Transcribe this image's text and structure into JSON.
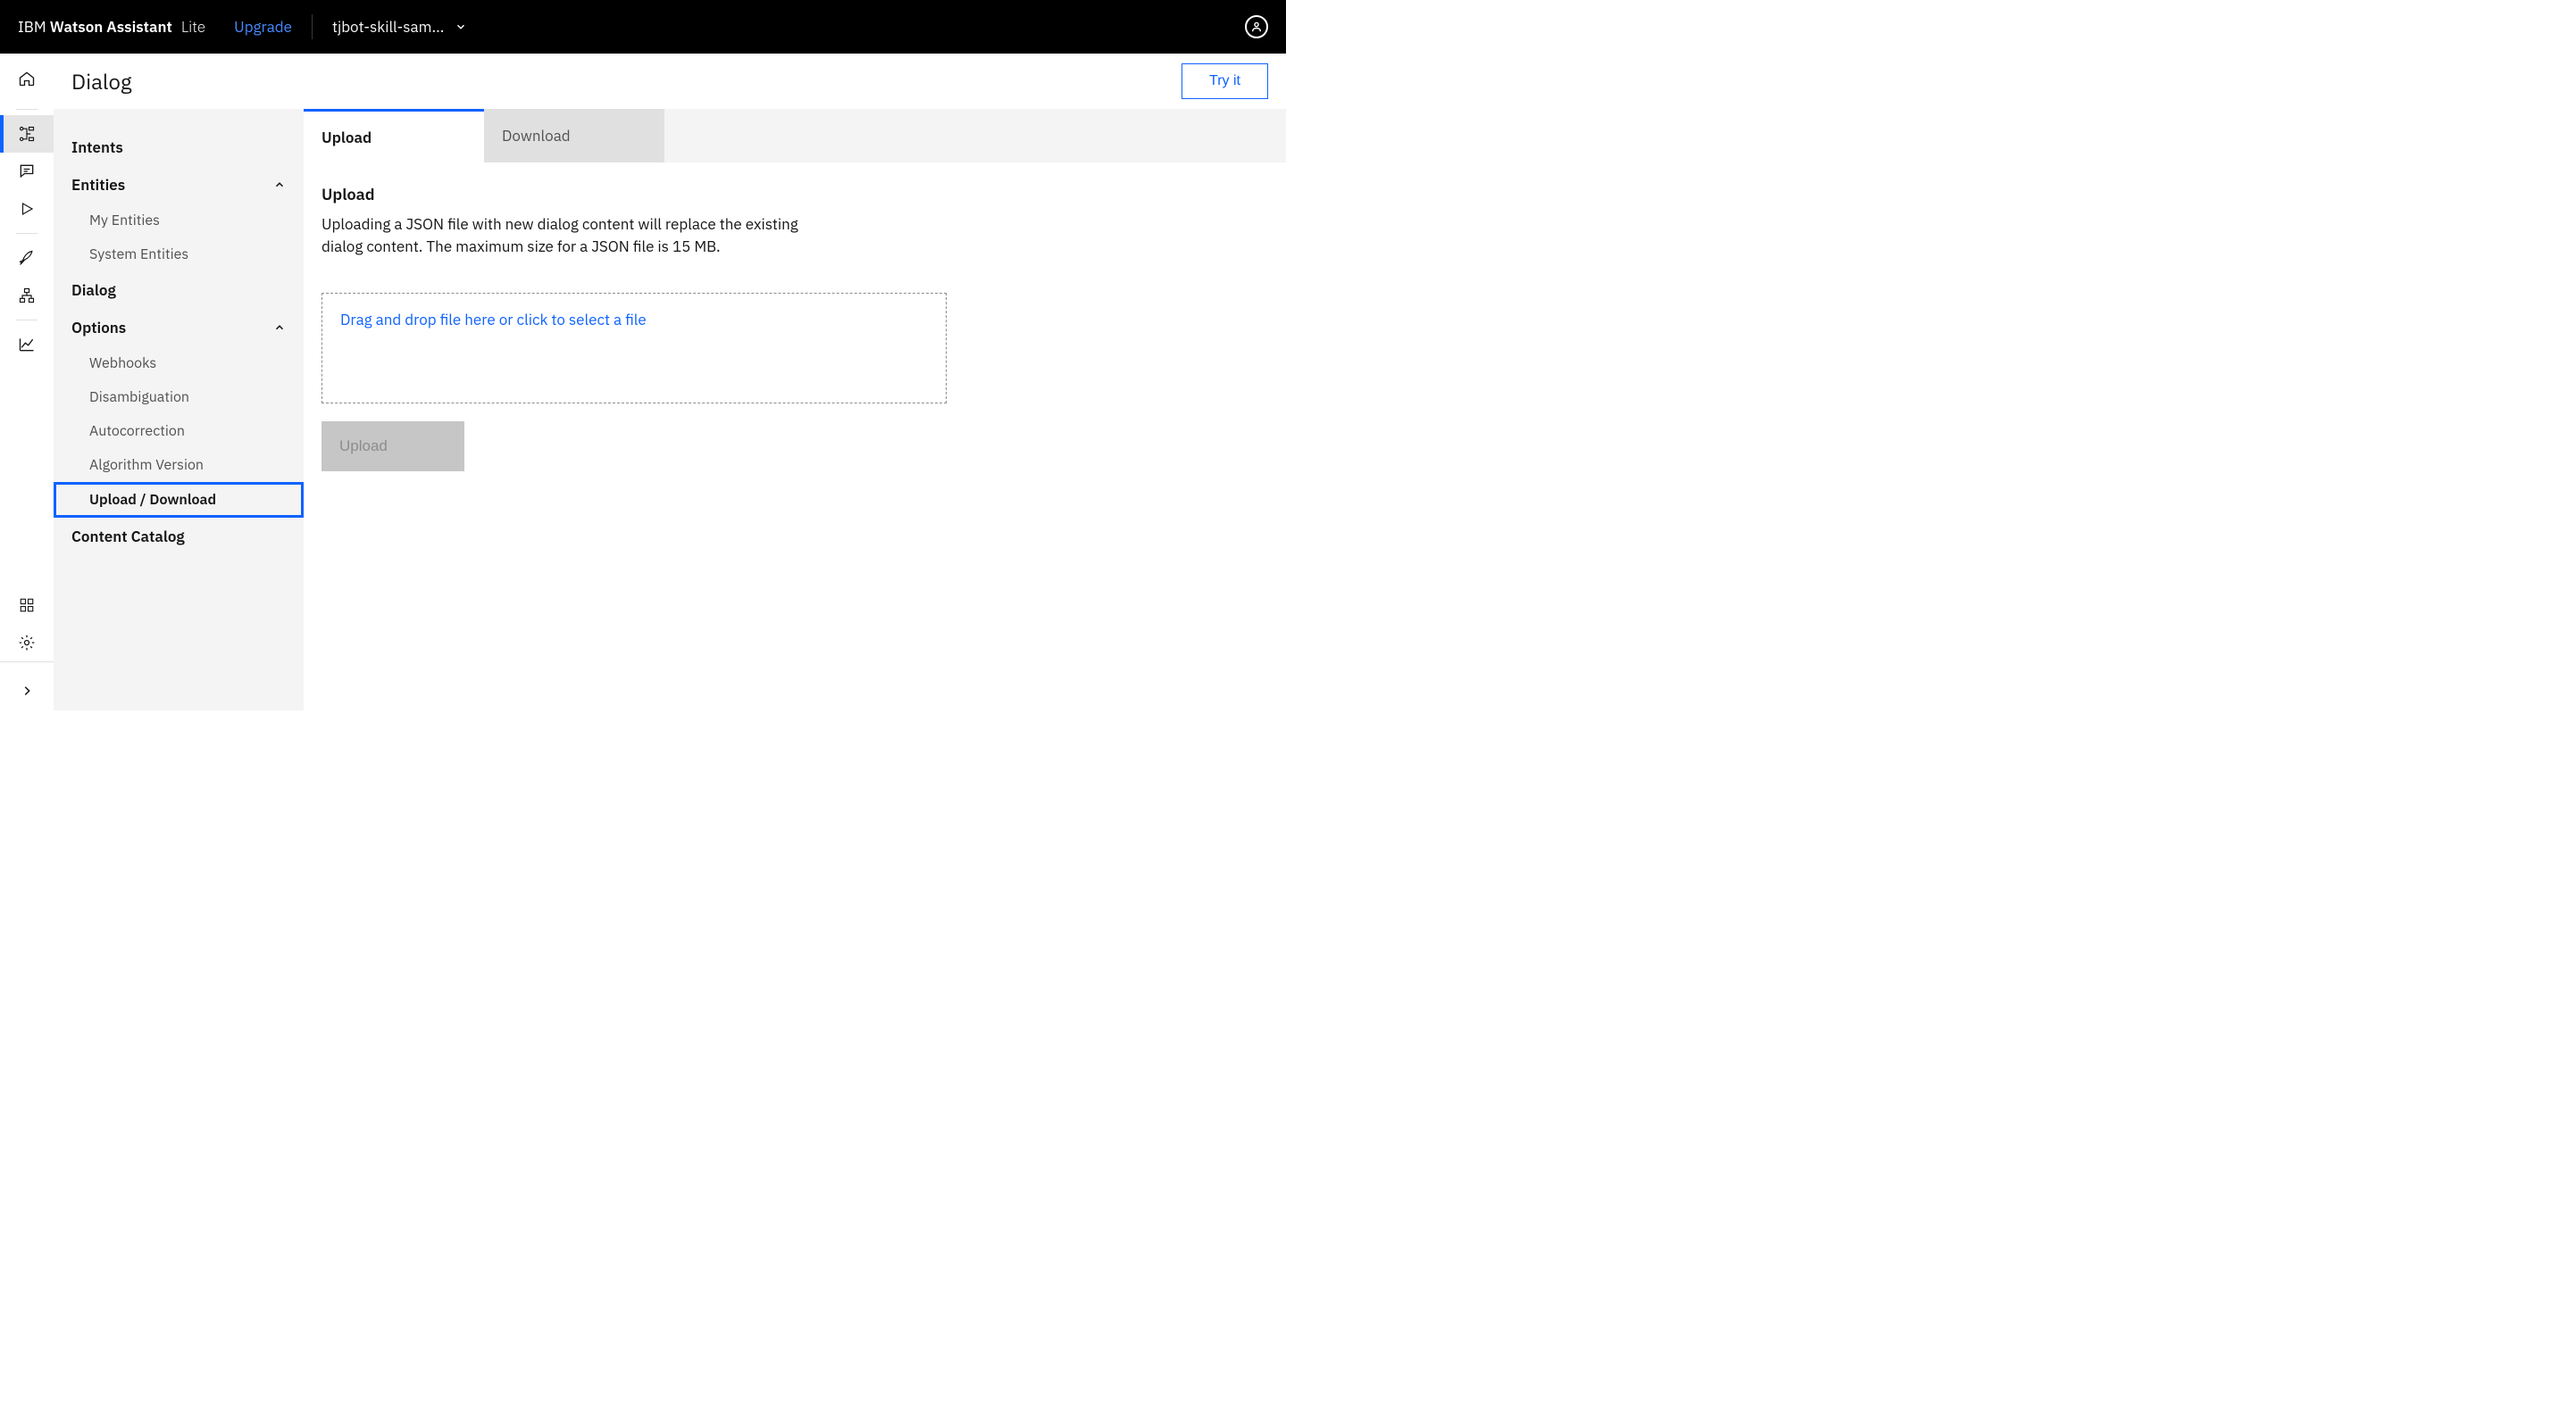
{
  "header": {
    "brand_prefix": "IBM",
    "brand_main": "Watson Assistant",
    "tier": "Lite",
    "upgrade": "Upgrade",
    "skill_name": "tjbot-skill-sam..."
  },
  "page": {
    "title": "Dialog",
    "try_it": "Try it"
  },
  "sidenav": {
    "intents": "Intents",
    "entities": "Entities",
    "my_entities": "My Entities",
    "system_entities": "System Entities",
    "dialog": "Dialog",
    "options": "Options",
    "webhooks": "Webhooks",
    "disambiguation": "Disambiguation",
    "autocorrection": "Autocorrection",
    "algorithm_version": "Algorithm Version",
    "upload_download": "Upload / Download",
    "content_catalog": "Content Catalog"
  },
  "tabs": {
    "upload": "Upload",
    "download": "Download"
  },
  "upload_panel": {
    "heading": "Upload",
    "description": "Uploading a JSON file with new dialog content will replace the existing dialog content. The maximum size for a JSON file is 15 MB.",
    "dropzone": "Drag and drop file here or click to select a file",
    "button": "Upload"
  }
}
